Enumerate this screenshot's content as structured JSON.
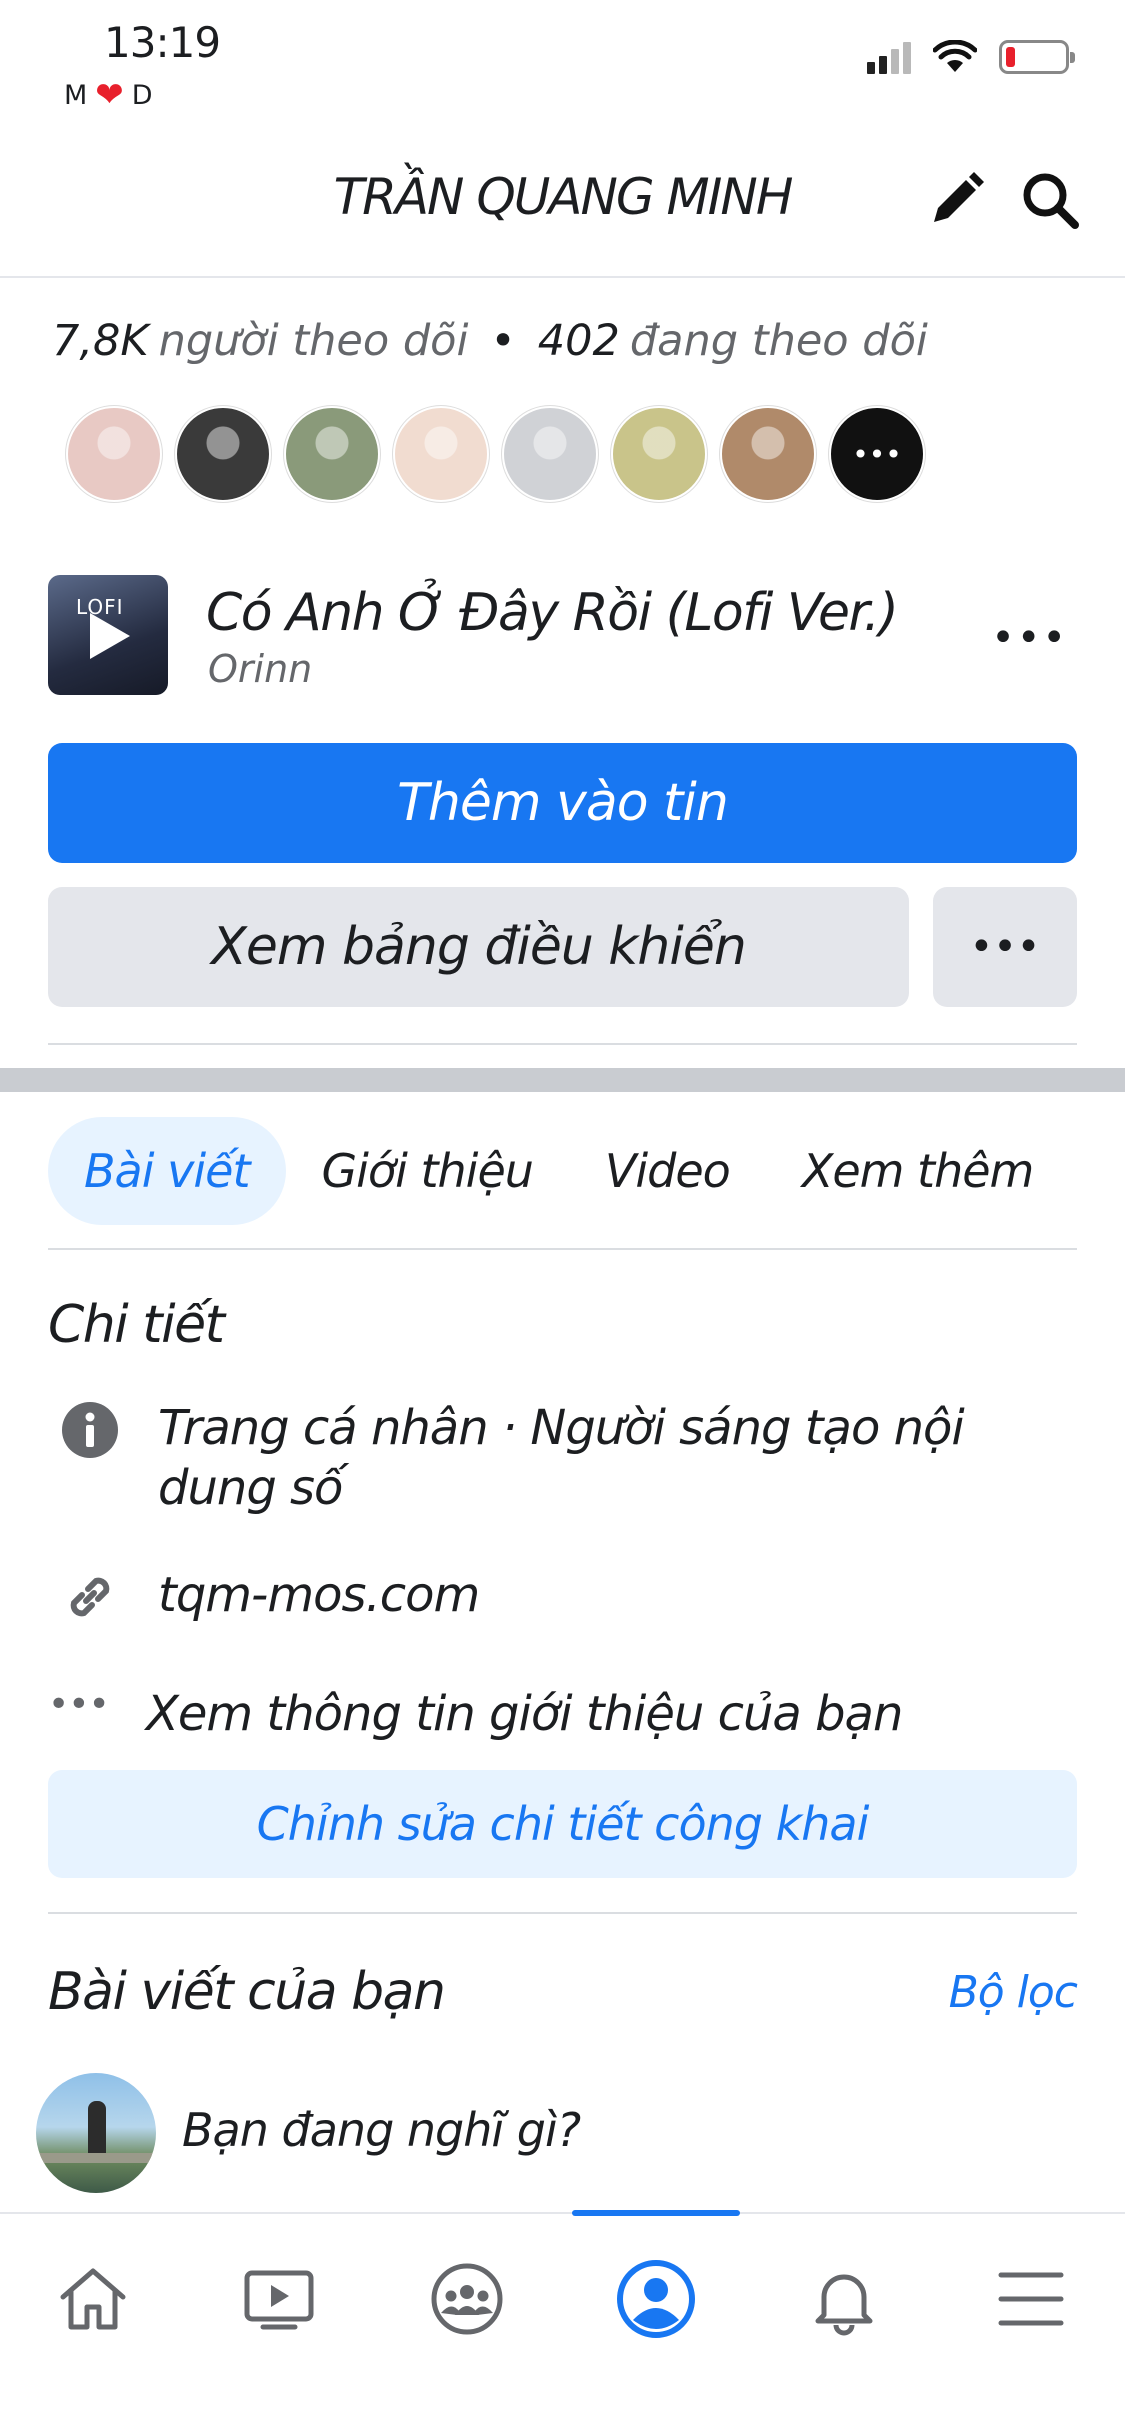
{
  "status_bar": {
    "time": "13:19",
    "carrier_left": "M",
    "carrier_right": "D",
    "battery_level": 0.15
  },
  "header": {
    "title": "TRẦN QUANG MINH",
    "edit_icon": "pencil-icon",
    "search_icon": "search-icon"
  },
  "followers": {
    "followers_count": "7,8K",
    "followers_label": "người theo dõi",
    "separator": "•",
    "following_count": "402",
    "following_label": "đang theo dõi"
  },
  "avatars": [
    {
      "name": "follower-avatar-1",
      "color": "#e8c9c4"
    },
    {
      "name": "follower-avatar-2",
      "color": "#3a3a3a"
    },
    {
      "name": "follower-avatar-3",
      "color": "#8a9a7a"
    },
    {
      "name": "follower-avatar-4",
      "color": "#f1dcd0"
    },
    {
      "name": "follower-avatar-5",
      "color": "#d0d2d6"
    },
    {
      "name": "follower-avatar-6",
      "color": "#c9c48a"
    },
    {
      "name": "follower-avatar-7",
      "color": "#b08a6a"
    }
  ],
  "avatars_more": "•••",
  "music": {
    "thumb_label": "LOFI",
    "title": "Có Anh Ở Đây Rồi (Lofi Ver.)",
    "artist": "Orinn",
    "more": "•••"
  },
  "buttons": {
    "add_to_story": "Thêm vào tin",
    "view_dashboard": "Xem bảng điều khiển",
    "more": "•••"
  },
  "tabs": [
    {
      "label": "Bài viết",
      "active": true
    },
    {
      "label": "Giới thiệu",
      "active": false
    },
    {
      "label": "Video",
      "active": false
    },
    {
      "label": "Xem thêm",
      "active": false
    }
  ],
  "details": {
    "title": "Chi tiết",
    "page_type": "Trang cá nhân · Người sáng tạo nội dung số",
    "website": "tqm-mos.com",
    "see_about": "Xem thông tin giới thiệu của bạn",
    "edit_button": "Chỉnh sửa chi tiết công khai"
  },
  "posts": {
    "title": "Bài viết của bạn",
    "filter": "Bộ lọc",
    "composer_placeholder": "Bạn đang nghĩ gì?"
  },
  "colors": {
    "accent": "#1877f2",
    "accent_light": "#e7f3ff",
    "secondary_button": "#e4e6eb",
    "text_muted": "#65676b"
  },
  "bottom_nav": [
    {
      "name": "home-icon",
      "active": false
    },
    {
      "name": "video-icon",
      "active": false
    },
    {
      "name": "groups-icon",
      "active": false
    },
    {
      "name": "profile-icon",
      "active": true
    },
    {
      "name": "notifications-icon",
      "active": false
    },
    {
      "name": "menu-icon",
      "active": false
    }
  ]
}
